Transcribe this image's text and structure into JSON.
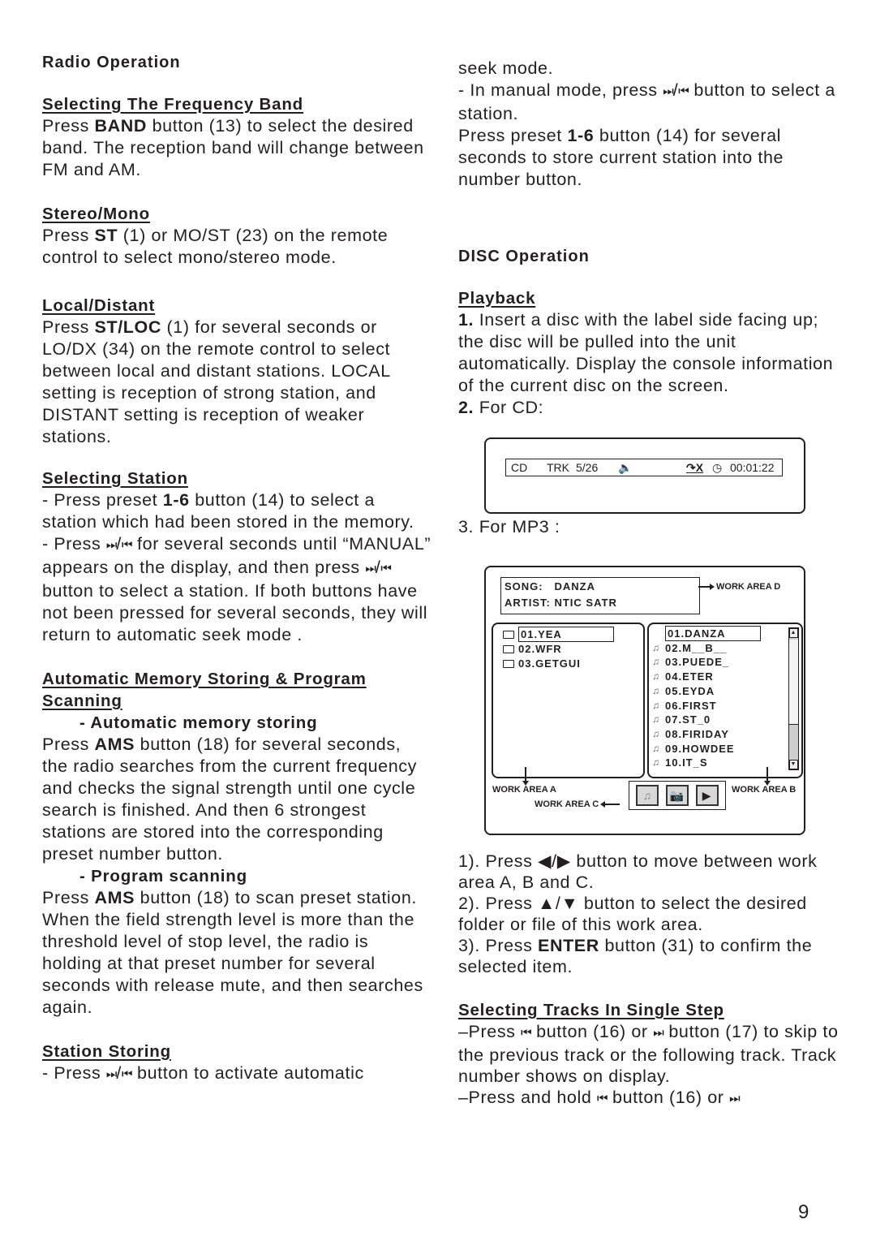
{
  "left": {
    "title": "Radio  Operation",
    "freq_band": {
      "heading": "Selecting The Frequency Band",
      "pre": "Press ",
      "bold": "BAND",
      "post": " button (13) to select the desired band. The reception band will change between FM and AM."
    },
    "stereo": {
      "heading": "Stereo/Mono",
      "pre": "Press ",
      "bold": "ST",
      "post": " (1) or MO/ST (23) on the remote control to select mono/stereo mode."
    },
    "local": {
      "heading": "Local/Distant",
      "pre": "Press ",
      "bold": "ST/LOC",
      "post": " (1) for several seconds or LO/DX (34) on the remote control to select between local and distant stations. LOCAL setting is reception of strong station, and DISTANT setting is reception of weaker stations."
    },
    "selecting_station": {
      "heading": "Selecting Station",
      "p1_pre": "- Press preset ",
      "p1_bold": "1-6",
      "p1_post": " button (14) to select a station which had been stored in the memory.",
      "p2_a": "- Press ",
      "p2_b": " for several seconds until “MANUAL” appears on the display, and then press ",
      "p2_c": " button to select a station. If both buttons have not been pressed for several seconds, they will return to automatic seek mode ."
    },
    "ams": {
      "heading": "Automatic Memory Storing & Program Scanning",
      "sub1": "- Automatic memory storing",
      "p1_pre": "Press ",
      "p1_bold": "AMS",
      "p1_post": " button (18) for several seconds, the radio searches from the current frequency and checks the signal strength until one cycle search is finished. And then 6 strongest stations are stored into the corresponding preset number button.",
      "sub2": "- Program scanning",
      "p2_pre": "Press ",
      "p2_bold": "AMS",
      "p2_post": " button (18) to scan preset station. When the field strength level is more than the threshold level of stop level, the radio is holding at that preset number for several seconds with release mute, and then searches again."
    },
    "station_storing": {
      "heading": "Station Storing",
      "p1_a": "- Press ",
      "p1_b": " button to activate automatic"
    }
  },
  "right": {
    "cont1": "seek mode.",
    "cont2_a": "- In manual mode, press ",
    "cont2_b": " button to select a station.",
    "cont3_pre": "Press preset ",
    "cont3_bold": "1-6",
    "cont3_post": " button (14) for several seconds to store current station into the number button.",
    "disc_title": "DISC  Operation",
    "playback": {
      "heading": "Playback",
      "s1_num": "1.",
      "s1_text": "  Insert a disc with the label side facing up; the disc will be pulled into the unit automatically. Display the console information of the current disc on the screen.",
      "s2_num": "2.",
      "s2_text": "  For CD:",
      "s3_text": "3. For MP3 :"
    },
    "cd_display": {
      "source": "CD",
      "track_label": "TRK",
      "track": "5/26",
      "speaker_icon": "speaker-icon",
      "repeat_icon": "repeat-off-icon",
      "clock_icon": "clock-icon",
      "time": "00:01:22"
    },
    "mp3_display": {
      "song_label": "SONG:",
      "song": "DANZA",
      "artist_label": "ARTIST:",
      "artist": "NTIC  SATR",
      "work_area_d": "WORK AREA  D",
      "work_area_a": "WORK AREA  A",
      "work_area_b": "WORK AREA  B",
      "work_area_c": "WORK AREA  C",
      "folders": [
        {
          "name": "01.YEA",
          "selected": true,
          "open": true
        },
        {
          "name": "02.WFR",
          "selected": false,
          "open": false
        },
        {
          "name": "03.GETGUI",
          "selected": false,
          "open": false
        }
      ],
      "files": [
        {
          "name": "01.DANZA",
          "selected": true
        },
        {
          "name": "02.M__B__",
          "selected": false
        },
        {
          "name": "03.PUEDE_",
          "selected": false
        },
        {
          "name": "04.ETER",
          "selected": false
        },
        {
          "name": "05.EYDA",
          "selected": false
        },
        {
          "name": "06.FIRST",
          "selected": false
        },
        {
          "name": "07.ST_0",
          "selected": false
        },
        {
          "name": "08.FIRIDAY",
          "selected": false
        },
        {
          "name": "09.HOWDEE",
          "selected": false
        },
        {
          "name": "10.IT_S",
          "selected": false
        }
      ],
      "controls": [
        "music-note-icon",
        "camera-icon",
        "play-icon"
      ]
    },
    "nav": {
      "n1_a": "1).  Press ◀/▶  button to move between work area  A, B and  C.",
      "n2": "2).  Press ▲/▼ button to select the desired folder or file of this work area.",
      "n3_pre": "3).  Press ",
      "n3_bold": "ENTER",
      "n3_post": " button (31) to confirm the selected item."
    },
    "single_step": {
      "heading": "Selecting Tracks In Single Step",
      "p1_a": "–Press ",
      "p1_b": " button (16) or ",
      "p1_c": " button (17) to skip to the previous track or the following track. Track number shows on display.",
      "p2_a": "–Press and hold ",
      "p2_b": " button (16) or "
    },
    "symbols": {
      "next": "⏭",
      "prev": "⏮",
      "slash": "/"
    }
  },
  "page_number": "9"
}
